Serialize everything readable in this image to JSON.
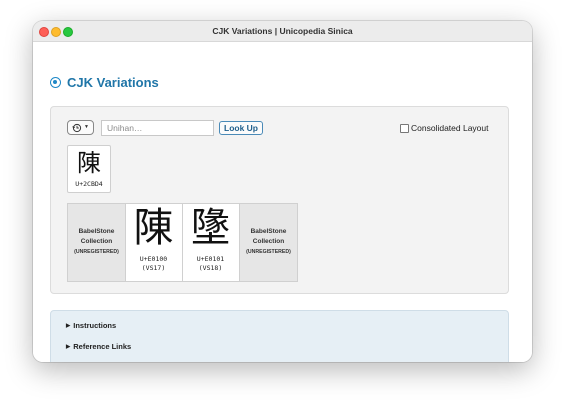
{
  "window": {
    "title": "CJK Variations | Unicopedia Sinica"
  },
  "page": {
    "heading": "CJK Variations"
  },
  "search": {
    "placeholder": "Unihan…",
    "lookup_label": "Look Up",
    "consolidated_label": "Consolidated Layout",
    "consolidated_checked": false,
    "history_icon": "history-clock-icon"
  },
  "character": {
    "glyph": "陳",
    "code": "U+2CBD4"
  },
  "variations": {
    "collection_left": {
      "name_line1": "BabelStone",
      "name_line2": "Collection",
      "status": "(UNREGISTERED)"
    },
    "collection_right": {
      "name_line1": "BabelStone",
      "name_line2": "Collection",
      "status": "(UNREGISTERED)"
    },
    "items": [
      {
        "glyph": "陳",
        "code": "U+E0100",
        "selector": "(VS17)"
      },
      {
        "glyph": "墬",
        "code": "U+E0101",
        "selector": "(VS18)"
      }
    ]
  },
  "sections": [
    {
      "label": "Instructions"
    },
    {
      "label": "Reference Links"
    }
  ],
  "colors": {
    "accent": "#2076a8",
    "info_bg": "#e6eff5"
  }
}
